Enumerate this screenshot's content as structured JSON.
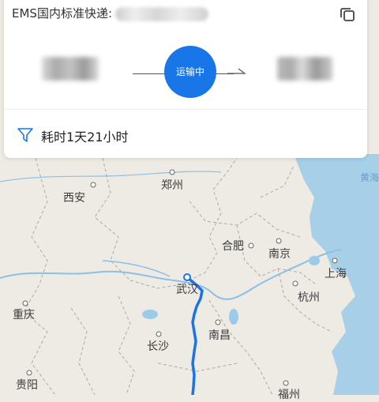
{
  "header": {
    "tracking_label": "EMS国内标准快递:",
    "status": "运输中",
    "duration": "耗时1天21小时"
  },
  "map": {
    "labels": {
      "xian": "西安",
      "zhengzhou": "郑州",
      "hefei": "合肥",
      "nanjing": "南京",
      "shanghai": "上海",
      "wuhan": "武汉",
      "hangzhou": "杭州",
      "chongqing": "重庆",
      "changsha": "长沙",
      "nanchang": "南昌",
      "guiyang": "贵阳",
      "fuzhou": "福州",
      "yellow_sea": "黄海"
    }
  },
  "colors": {
    "status_blue": "#1976e8",
    "route_blue": "#1a73e8",
    "land": "#eeeae4",
    "water": "#a8cfe8"
  }
}
